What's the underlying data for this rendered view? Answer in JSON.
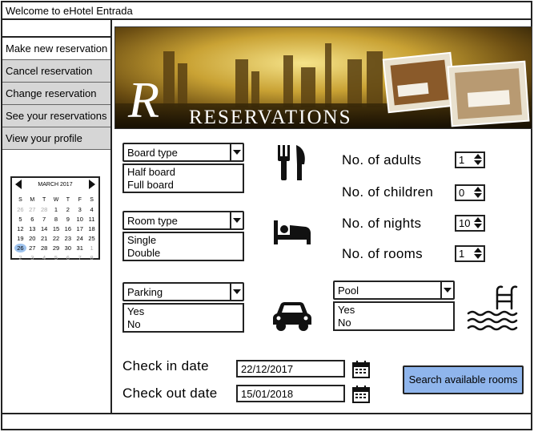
{
  "window": {
    "title": "Welcome to eHotel Entrada"
  },
  "sidebar": {
    "items": [
      {
        "label": "Make new reservation",
        "active": true
      },
      {
        "label": "Cancel reservation"
      },
      {
        "label": "Change reservation"
      },
      {
        "label": "See your reservations"
      },
      {
        "label": "View your profile"
      }
    ]
  },
  "calendar": {
    "month": "MARCH 2017",
    "weekdays": [
      "S",
      "M",
      "T",
      "W",
      "T",
      "F",
      "S"
    ],
    "selected_day": "26",
    "weeks": [
      [
        "26",
        "27",
        "28",
        "1",
        "2",
        "3",
        "4"
      ],
      [
        "5",
        "6",
        "7",
        "8",
        "9",
        "10",
        "11"
      ],
      [
        "12",
        "13",
        "14",
        "15",
        "16",
        "17",
        "18"
      ],
      [
        "19",
        "20",
        "21",
        "22",
        "23",
        "24",
        "25"
      ],
      [
        "26",
        "27",
        "28",
        "29",
        "30",
        "31",
        "1"
      ],
      [
        "2",
        "3",
        "4",
        "5",
        "6",
        "7",
        "8"
      ]
    ]
  },
  "banner": {
    "title": "RESERVATIONS"
  },
  "board": {
    "label": "Board type",
    "options": [
      "Half board",
      "Full board"
    ],
    "icon": "fork-knife-icon"
  },
  "room": {
    "label": "Room type",
    "options": [
      "Single",
      "Double"
    ],
    "icon": "bed-icon"
  },
  "parking": {
    "label": "Parking",
    "options": [
      "Yes",
      "No"
    ],
    "icon": "car-icon"
  },
  "pool": {
    "label": "Pool",
    "options": [
      "Yes",
      "No"
    ],
    "icon": "pool-icon"
  },
  "counts": {
    "adults": {
      "label": "No. of adults",
      "value": "1"
    },
    "children": {
      "label": "No. of children",
      "value": "0"
    },
    "nights": {
      "label": "No. of nights",
      "value": "10"
    },
    "rooms": {
      "label": "No. of rooms",
      "value": "1"
    }
  },
  "dates": {
    "checkin": {
      "label": "Check in date",
      "value": "22/12/2017"
    },
    "checkout": {
      "label": "Check out date",
      "value": "15/01/2018"
    }
  },
  "actions": {
    "search": "Search available rooms"
  },
  "colors": {
    "button": "#8fb5ec",
    "menu_bg": "#d6d6d6",
    "calendar_selected": "#9ec3ee"
  }
}
